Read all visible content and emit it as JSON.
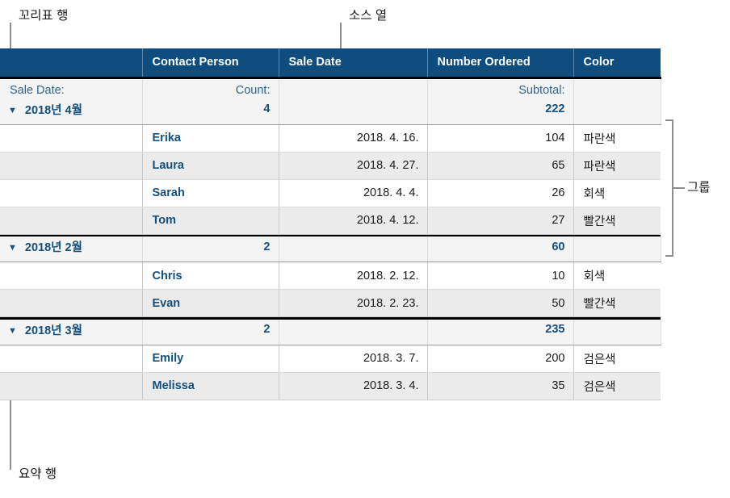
{
  "annotations": {
    "tag_row": "꼬리표 행",
    "source_column": "소스 열",
    "group": "그룹",
    "summary_row": "요약 행"
  },
  "table": {
    "headers": [
      "",
      "Contact Person",
      "Sale Date",
      "Number Ordered",
      "Color"
    ],
    "label_row": {
      "category_label": "Sale Date:",
      "count_label": "Count:",
      "date_label": "",
      "subtotal_label": "Subtotal:",
      "color_label": ""
    },
    "disclosure_glyph": "▼",
    "groups": [
      {
        "name": "2018년 4월",
        "count": "4",
        "subtotal": "222",
        "rows": [
          {
            "person": "Erika",
            "date": "2018. 4. 16.",
            "number": "104",
            "color": "파란색"
          },
          {
            "person": "Laura",
            "date": "2018. 4. 27.",
            "number": "65",
            "color": "파란색"
          },
          {
            "person": "Sarah",
            "date": "2018. 4. 4.",
            "number": "26",
            "color": "회색"
          },
          {
            "person": "Tom",
            "date": "2018. 4. 12.",
            "number": "27",
            "color": "빨간색"
          }
        ]
      },
      {
        "name": "2018년 2월",
        "count": "2",
        "subtotal": "60",
        "rows": [
          {
            "person": "Chris",
            "date": "2018. 2. 12.",
            "number": "10",
            "color": "회색"
          },
          {
            "person": "Evan",
            "date": "2018. 2. 23.",
            "number": "50",
            "color": "빨간색"
          }
        ]
      },
      {
        "name": "2018년 3월",
        "count": "2",
        "subtotal": "235",
        "rows": [
          {
            "person": "Emily",
            "date": "2018. 3. 7.",
            "number": "200",
            "color": "검은색"
          },
          {
            "person": "Melissa",
            "date": "2018. 3. 4.",
            "number": "35",
            "color": "검은색"
          }
        ]
      }
    ]
  },
  "colors": {
    "header_bg": "#0e4d7d",
    "header_text": "#ffffff",
    "accent_text": "#14507f",
    "label_text": "#2a6496",
    "summary_bg": "#f4f4f4",
    "alt_row_bg": "#ebebeb",
    "row_bg": "#ffffff",
    "callout_line": "#8e8e8e",
    "heavy_rule": "#000000"
  }
}
